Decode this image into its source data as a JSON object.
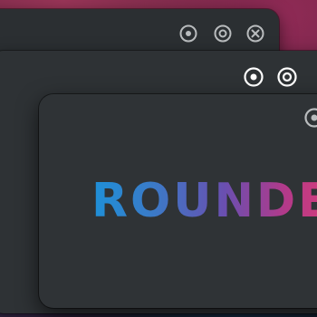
{
  "windows": {
    "back": {
      "buttons": [
        "minimize-button",
        "maximize-button",
        "close-button"
      ]
    },
    "middle": {
      "buttons": [
        "minimize-button",
        "maximize-button"
      ]
    },
    "front": {
      "text": "ROUNDE",
      "buttons": [
        "minimize-button"
      ]
    }
  },
  "colors": {
    "window_bg": "#2f3336",
    "button_inactive": "#b9bcbe",
    "button_active": "#ffffff",
    "text_gradient_start": "#1e90d8",
    "text_gradient_end": "#d63c7a"
  }
}
